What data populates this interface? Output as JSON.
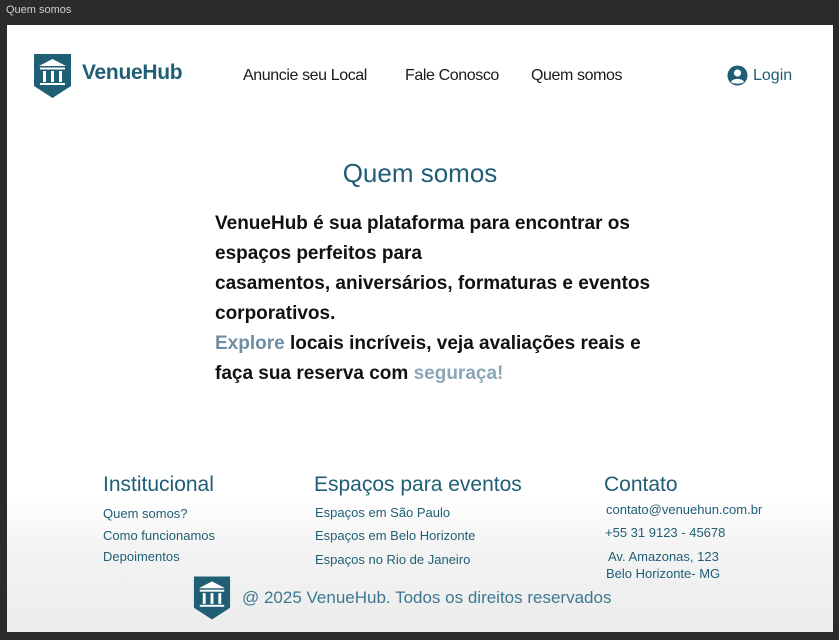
{
  "window": {
    "title": "Quem somos"
  },
  "header": {
    "brand": "VenueHub",
    "logo_icon": "museum-shield-icon",
    "nav": [
      {
        "label": "Anuncie seu Local"
      },
      {
        "label": "Fale Conosco"
      },
      {
        "label": "Quem somos"
      }
    ],
    "login_label": "Login",
    "login_icon": "user-circle-icon"
  },
  "main": {
    "title": "Quem somos",
    "p1": "VenueHub é sua plataforma para encontrar os espaços perfeitos para",
    "p2": "casamentos, aniversários, formaturas e eventos corporativos.",
    "explore": "Explore",
    "p3": "locais incríveis, veja avaliações reais e faça sua reserva com",
    "seguranca": "seguraça!"
  },
  "footer": {
    "institucional": {
      "heading": "Institucional",
      "links": [
        "Quem somos?",
        "Como funcionamos",
        "Depoimentos"
      ]
    },
    "espacos": {
      "heading": "Espaços para eventos",
      "links": [
        "Espaços em São Paulo",
        "Espaços em Belo Horizonte",
        "Espaços no Rio de Janeiro"
      ]
    },
    "contato": {
      "heading": "Contato",
      "email": "contato@venuehun.com.br",
      "phone": "+55 31 9123 - 45678",
      "address1": "Av. Amazonas, 123",
      "address2": "Belo Horizonte- MG"
    },
    "copyright": "@ 2025 VenueHub. Todos os direitos reservados"
  },
  "colors": {
    "brand": "#1f5e74",
    "highlight": "#6f8ea3",
    "window_bg": "#2b2b2b"
  }
}
